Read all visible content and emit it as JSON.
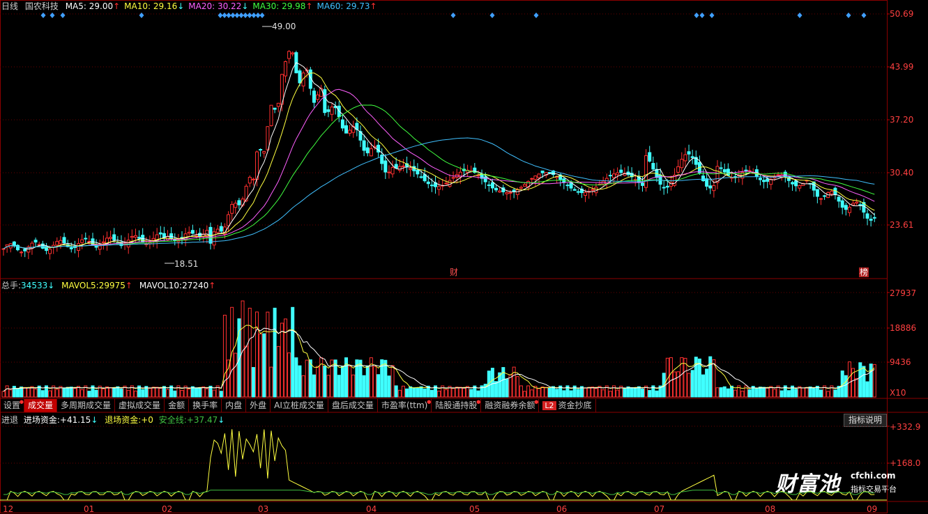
{
  "header": {
    "period": "日线",
    "stock_name": "国农科技",
    "ma": [
      {
        "label": "MA5",
        "value": "29.00",
        "arrow": "↑",
        "color": "#ffffff",
        "arrow_color": "#ff3030"
      },
      {
        "label": "MA10",
        "value": "29.16",
        "arrow": "↓",
        "color": "#ffff40",
        "arrow_color": "#40ffff"
      },
      {
        "label": "MA20",
        "value": "30.22",
        "arrow": "↓",
        "color": "#ff60ff",
        "arrow_color": "#40ffff"
      },
      {
        "label": "MA30",
        "value": "29.98",
        "arrow": "↑",
        "color": "#40ff40",
        "arrow_color": "#ff3030"
      },
      {
        "label": "MA60",
        "value": "29.73",
        "arrow": "↑",
        "color": "#40c0ff",
        "arrow_color": "#ff3030"
      }
    ]
  },
  "price_axis": [
    "50.69",
    "43.99",
    "37.20",
    "30.40",
    "23.61"
  ],
  "annotations": {
    "high": "49.00",
    "low": "18.51",
    "cai": "财",
    "bang": "榜"
  },
  "volume_header": {
    "total_label": "总手:",
    "total_value": "34533",
    "total_arrow": "↓",
    "mavol5_label": "MAVOL5:",
    "mavol5_value": "29975",
    "mavol5_arrow": "↑",
    "mavol10_label": "MAVOL10:",
    "mavol10_value": "27240",
    "mavol10_arrow": "↑"
  },
  "volume_axis": [
    "27937",
    "18886",
    "9436",
    "X10"
  ],
  "tabs": [
    {
      "label": "设置",
      "dot": true
    },
    {
      "label": "成交量",
      "active": true
    },
    {
      "label": "多周期成交量"
    },
    {
      "label": "虚拟成交量"
    },
    {
      "label": "金额"
    },
    {
      "label": "换手率"
    },
    {
      "label": "内盘"
    },
    {
      "label": "外盘"
    },
    {
      "label": "AI立桩成交量"
    },
    {
      "label": "盘后成交量"
    },
    {
      "label": "市盈率(ttm)",
      "dot": true
    },
    {
      "label": "陆股通持股",
      "dot": true
    },
    {
      "label": "融资融券余额",
      "dot": true
    },
    {
      "label": "资金抄底",
      "badge": "L2"
    }
  ],
  "indicator": {
    "name": "进退",
    "entry_label": "进场资金:",
    "entry_value": "+41.15",
    "entry_arrow": "↓",
    "exit_label": "退场资金:",
    "exit_value": "+0",
    "safe_label": "安全线:",
    "safe_value": "+37.47",
    "safe_arrow": "↓",
    "help_button": "指标说明",
    "axis": [
      "+332.9",
      "+168.0"
    ]
  },
  "x_axis": [
    "12",
    "01",
    "02",
    "03",
    "04",
    "05",
    "06",
    "07",
    "08",
    "09"
  ],
  "watermark": {
    "brand": "财富池",
    "domain": "cfchi.com",
    "slogan": "指标交易平台"
  },
  "colors": {
    "up": "#ff3030",
    "down": "#40ffff",
    "grid": "#8b0000",
    "axis_text": "#ff4040"
  }
}
